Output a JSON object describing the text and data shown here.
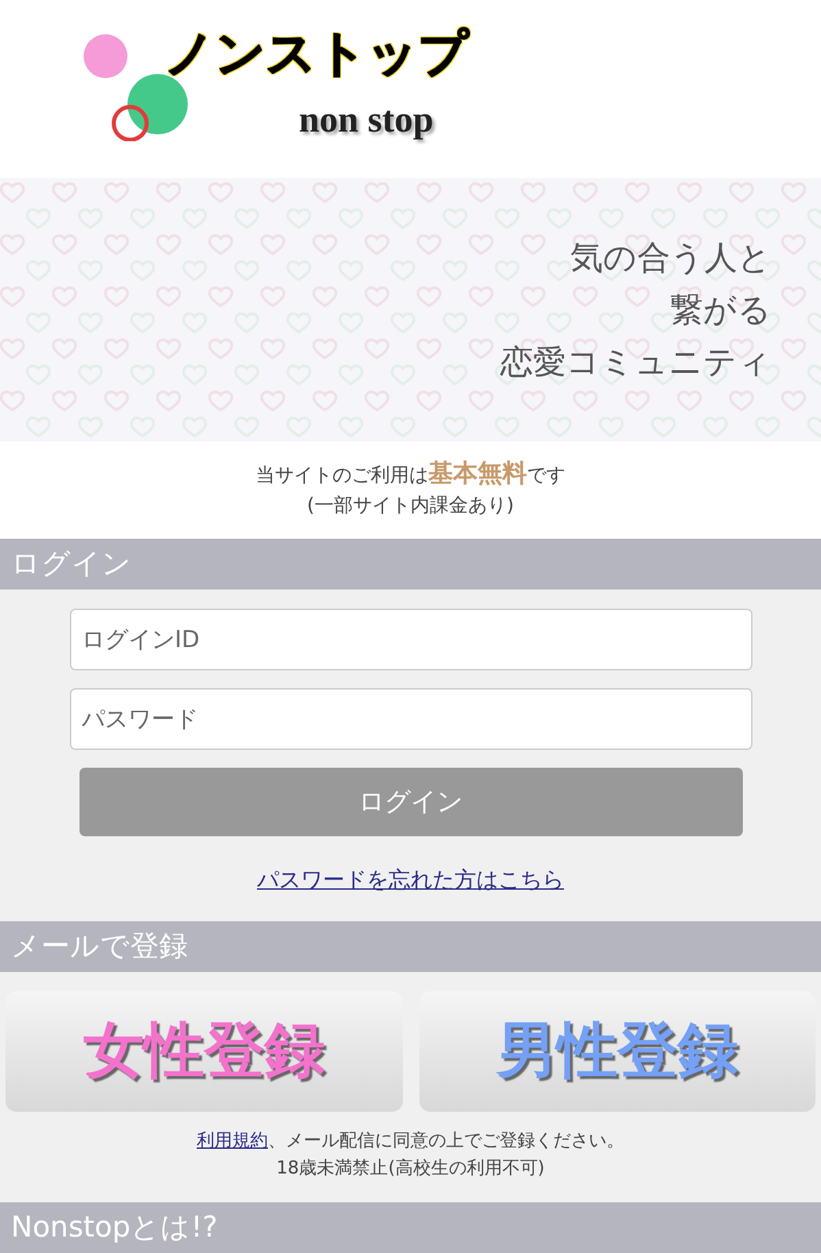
{
  "logo": {
    "title": "ノンストップ",
    "subtitle": "non stop"
  },
  "hero": {
    "lines": [
      "気の合う人と",
      "繋がる",
      "恋愛コミュニティ"
    ]
  },
  "notice": {
    "text": "当サイトのご利用は**基本無料**です",
    "note": "(一部サイト内課金あり)"
  },
  "login": {
    "heading": "ログイン",
    "id_field": {
      "placeholder": "ログインID"
    },
    "password_field": {
      "placeholder": "パスワード"
    },
    "button": "ログイン",
    "forgot_link": "パスワードを忘れた方はこちら"
  },
  "register": {
    "heading": "メールで登録",
    "buttons": [
      {
        "label": "女性登録",
        "color": "#f272cc"
      },
      {
        "label": "男性登録",
        "color": "#74a0f5"
      }
    ],
    "terms_link": "利用規約",
    "terms_text": "、メール配信に同意の上でご登録ください。",
    "age_note": "18歳未満禁止(高校生の利用不可)"
  },
  "about": {
    "heading": "Nonstopとは!?"
  }
}
